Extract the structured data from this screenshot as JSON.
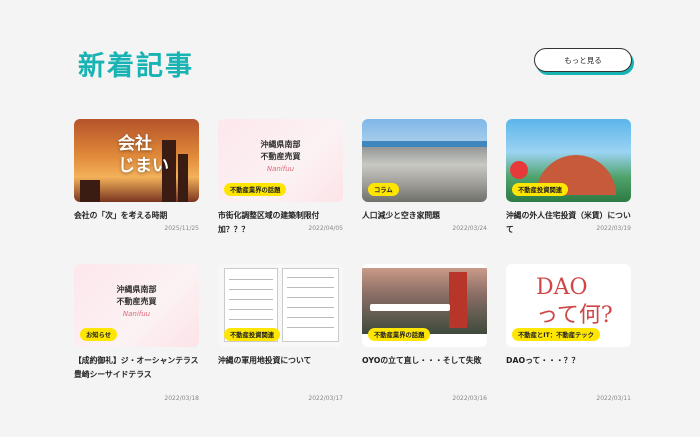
{
  "header": {
    "title": "新着記事",
    "more_label": "もっと見る"
  },
  "articles": [
    {
      "title": "会社の「次」を考える時期",
      "date": "2025/11/25",
      "tag": "",
      "thumb_text": "会社\nじまい"
    },
    {
      "title": "市街化調整区域の建築制限付加？？？",
      "date": "2022/04/05",
      "tag": "不動産業界の話題",
      "thumb_text": "沖縄県南部\n不動産売買",
      "thumb_sig": "Nanifuu"
    },
    {
      "title": "人口減少と空き家問題",
      "date": "2022/03/24",
      "tag": "コラム"
    },
    {
      "title": "沖縄の外人住宅投資（米賃）について",
      "date": "2022/03/19",
      "tag": "不動産投資関連"
    },
    {
      "title": "【成約御礼】ジ・オーシャンテラス豊崎シーサイドテラス",
      "date": "2022/03/18",
      "tag": "お知らせ",
      "thumb_text": "沖縄県南部\n不動産売買",
      "thumb_sig": "Nanifuu"
    },
    {
      "title": "沖縄の軍用地投資について",
      "date": "2022/03/17",
      "tag": "不動産投資関連"
    },
    {
      "title": "OYOの立て直し・・・そして失敗",
      "date": "2022/03/16",
      "tag": "不動産業界の話題"
    },
    {
      "title": "DAOって・・・？？",
      "date": "2022/03/11",
      "tag": "不動産とIT：不動産テック",
      "thumb_text": "DAO\nって何?"
    }
  ]
}
